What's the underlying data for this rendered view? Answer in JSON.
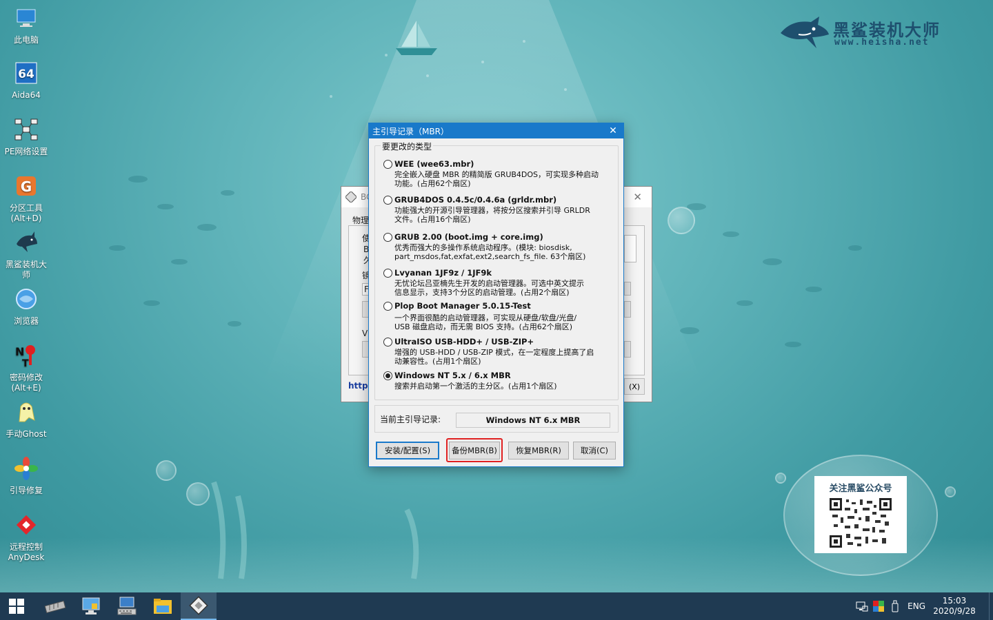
{
  "desktop": {
    "icons": [
      {
        "label": "此电脑",
        "icon": "this-pc-icon"
      },
      {
        "label": "Aida64",
        "icon": "aida64-icon"
      },
      {
        "label": "PE网络设置",
        "icon": "network-settings-icon"
      },
      {
        "label": "分区工具\n(Alt+D)",
        "icon": "partition-tool-icon"
      },
      {
        "label": "黑鲨装机大\n师",
        "icon": "heisha-shark-icon"
      },
      {
        "label": "浏览器",
        "icon": "browser-icon"
      },
      {
        "label": "密码修改\n(Alt+E)",
        "icon": "password-tool-icon"
      },
      {
        "label": "手动Ghost",
        "icon": "ghost-icon"
      },
      {
        "label": "引导修复",
        "icon": "boot-repair-icon"
      },
      {
        "label": "远程控制\nAnyDesk",
        "icon": "anydesk-icon"
      }
    ]
  },
  "brand": {
    "name": "黑鲨装机大师",
    "url": "www.heisha.net"
  },
  "qr": {
    "title": "关注黑鲨公众号"
  },
  "bg_window": {
    "title": "BC",
    "tab": "物理",
    "frag1": "使",
    "frag2": "B",
    "frag3": "久",
    "frag4": "镜",
    "frag5": "F",
    "frag6": "VI",
    "link": "http:",
    "btn_frag": "(X)"
  },
  "dialog": {
    "title": "主引导记录（MBR）",
    "group_label": "要更改的类型",
    "options": [
      {
        "label": "WEE (wee63.mbr)",
        "desc": "完全嵌入硬盘 MBR 的精简版 GRUB4DOS，可实现多种启动\n功能。(占用62个扇区)",
        "selected": false
      },
      {
        "label": "GRUB4DOS 0.4.5c/0.4.6a (grldr.mbr)",
        "desc": "功能强大的开源引导管理器，将按分区搜索并引导 GRLDR\n文件。(占用16个扇区)",
        "selected": false
      },
      {
        "label": "GRUB 2.00 (boot.img + core.img)",
        "desc": "优秀而强大的多操作系统启动程序。(模块: biosdisk,\npart_msdos,fat,exfat,ext2,search_fs_file. 63个扇区)",
        "selected": false
      },
      {
        "label": "Lvyanan 1JF9z / 1JF9k",
        "desc": "无忧论坛吕亚楠先生开发的启动管理器。可选中英文提示\n信息显示，支持3个分区的启动管理。(占用2个扇区)",
        "selected": false
      },
      {
        "label": "Plop Boot Manager 5.0.15-Test",
        "desc": "一个界面很酷的启动管理器，可实现从硬盘/软盘/光盘/\nUSB 磁盘启动，而无需 BIOS 支持。(占用62个扇区)",
        "selected": false
      },
      {
        "label": "UltraISO USB-HDD+ / USB-ZIP+",
        "desc": "增强的 USB-HDD / USB-ZIP 模式，在一定程度上提高了启\n动兼容性。(占用1个扇区)",
        "selected": false
      },
      {
        "label": "Windows NT 5.x / 6.x MBR",
        "desc": "搜索并启动第一个激活的主分区。(占用1个扇区)",
        "selected": true
      }
    ],
    "current_label": "当前主引导记录:",
    "current_value": "Windows NT 6.x MBR",
    "buttons": {
      "install": "安装/配置(S)",
      "backup": "备份MBR(B)",
      "restore": "恢复MBR(R)",
      "cancel": "取消(C)"
    }
  },
  "taskbar": {
    "apps": [
      "drive-tool-icon",
      "network-pc-icon",
      "keyboard-pc-icon",
      "file-explorer-icon",
      "bootice-icon"
    ],
    "lang": "ENG",
    "time": "15:03",
    "date": "2020/9/28"
  },
  "colors": {
    "titlebar": "#1979ca",
    "taskbar": "#1f3a52",
    "highlight": "#e02020"
  }
}
